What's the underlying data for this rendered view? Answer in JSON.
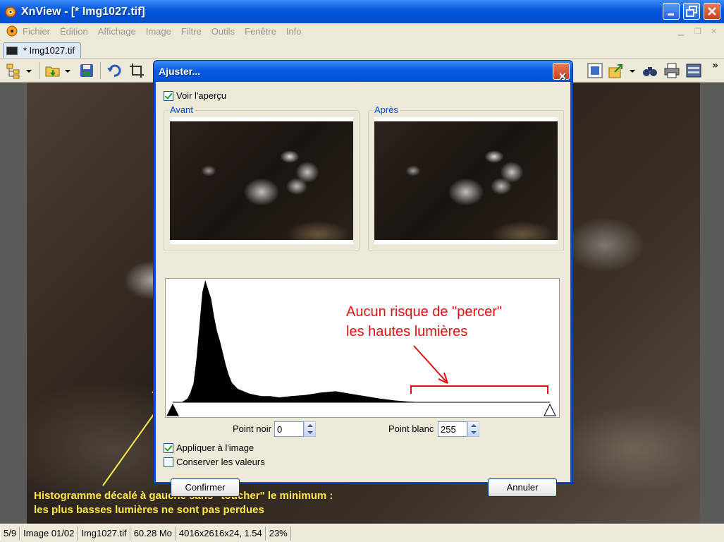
{
  "window": {
    "title": "XnView - [* Img1027.tif]"
  },
  "menu": {
    "items": [
      "Fichier",
      "Édition",
      "Affichage",
      "Image",
      "Filtre",
      "Outils",
      "Fenêtre",
      "Info"
    ]
  },
  "tab": {
    "label": "* Img1027.tif"
  },
  "toolbar": {
    "more": "»"
  },
  "dialog": {
    "title": "Ajuster...",
    "close": "✕",
    "preview_checkbox": {
      "label": "Voir l'aperçu",
      "checked": true
    },
    "before_label": "Avant",
    "after_label": "Après",
    "black_point": {
      "label": "Point noir",
      "value": "0"
    },
    "white_point": {
      "label": "Point blanc",
      "value": "255"
    },
    "apply_checkbox": {
      "label": "Appliquer à l'image",
      "checked": true
    },
    "keep_checkbox": {
      "label": "Conserver les valeurs",
      "checked": false
    },
    "confirm_label": "Confirmer",
    "cancel_label": "Annuler"
  },
  "annotations": {
    "red_line1": "Aucun risque de \"percer\"",
    "red_line2": "les hautes lumières",
    "yellow_line1": "Histogramme décalé à gauche sans \"toucher\" le minimum :",
    "yellow_line2": "les plus basses lumières ne sont pas perdues",
    "red_color": "#e01010",
    "yellow_color": "#ffe94a"
  },
  "chart_data": {
    "type": "area",
    "x": [
      0,
      6,
      10,
      12,
      13,
      14,
      16,
      18,
      20,
      22,
      24,
      26,
      28,
      30,
      32,
      34,
      36,
      38,
      40,
      44,
      48,
      52,
      56,
      60,
      66,
      72,
      80,
      90,
      100,
      110,
      120,
      130,
      140,
      150,
      160,
      170,
      180,
      190,
      200,
      210,
      220,
      230,
      240,
      250,
      255
    ],
    "values": [
      0,
      0,
      0.03,
      0.08,
      0.12,
      0.15,
      0.35,
      0.62,
      0.9,
      1.0,
      0.92,
      0.85,
      0.7,
      0.58,
      0.5,
      0.4,
      0.3,
      0.22,
      0.16,
      0.11,
      0.09,
      0.07,
      0.06,
      0.05,
      0.05,
      0.04,
      0.05,
      0.06,
      0.08,
      0.09,
      0.07,
      0.05,
      0.03,
      0.015,
      0.005,
      0,
      0,
      0,
      0,
      0,
      0,
      0,
      0,
      0,
      0
    ],
    "xlim": [
      0,
      255
    ],
    "ylim": [
      0,
      1
    ],
    "grid": false,
    "markers": {
      "black_point": 0,
      "white_point": 255
    }
  }
}
